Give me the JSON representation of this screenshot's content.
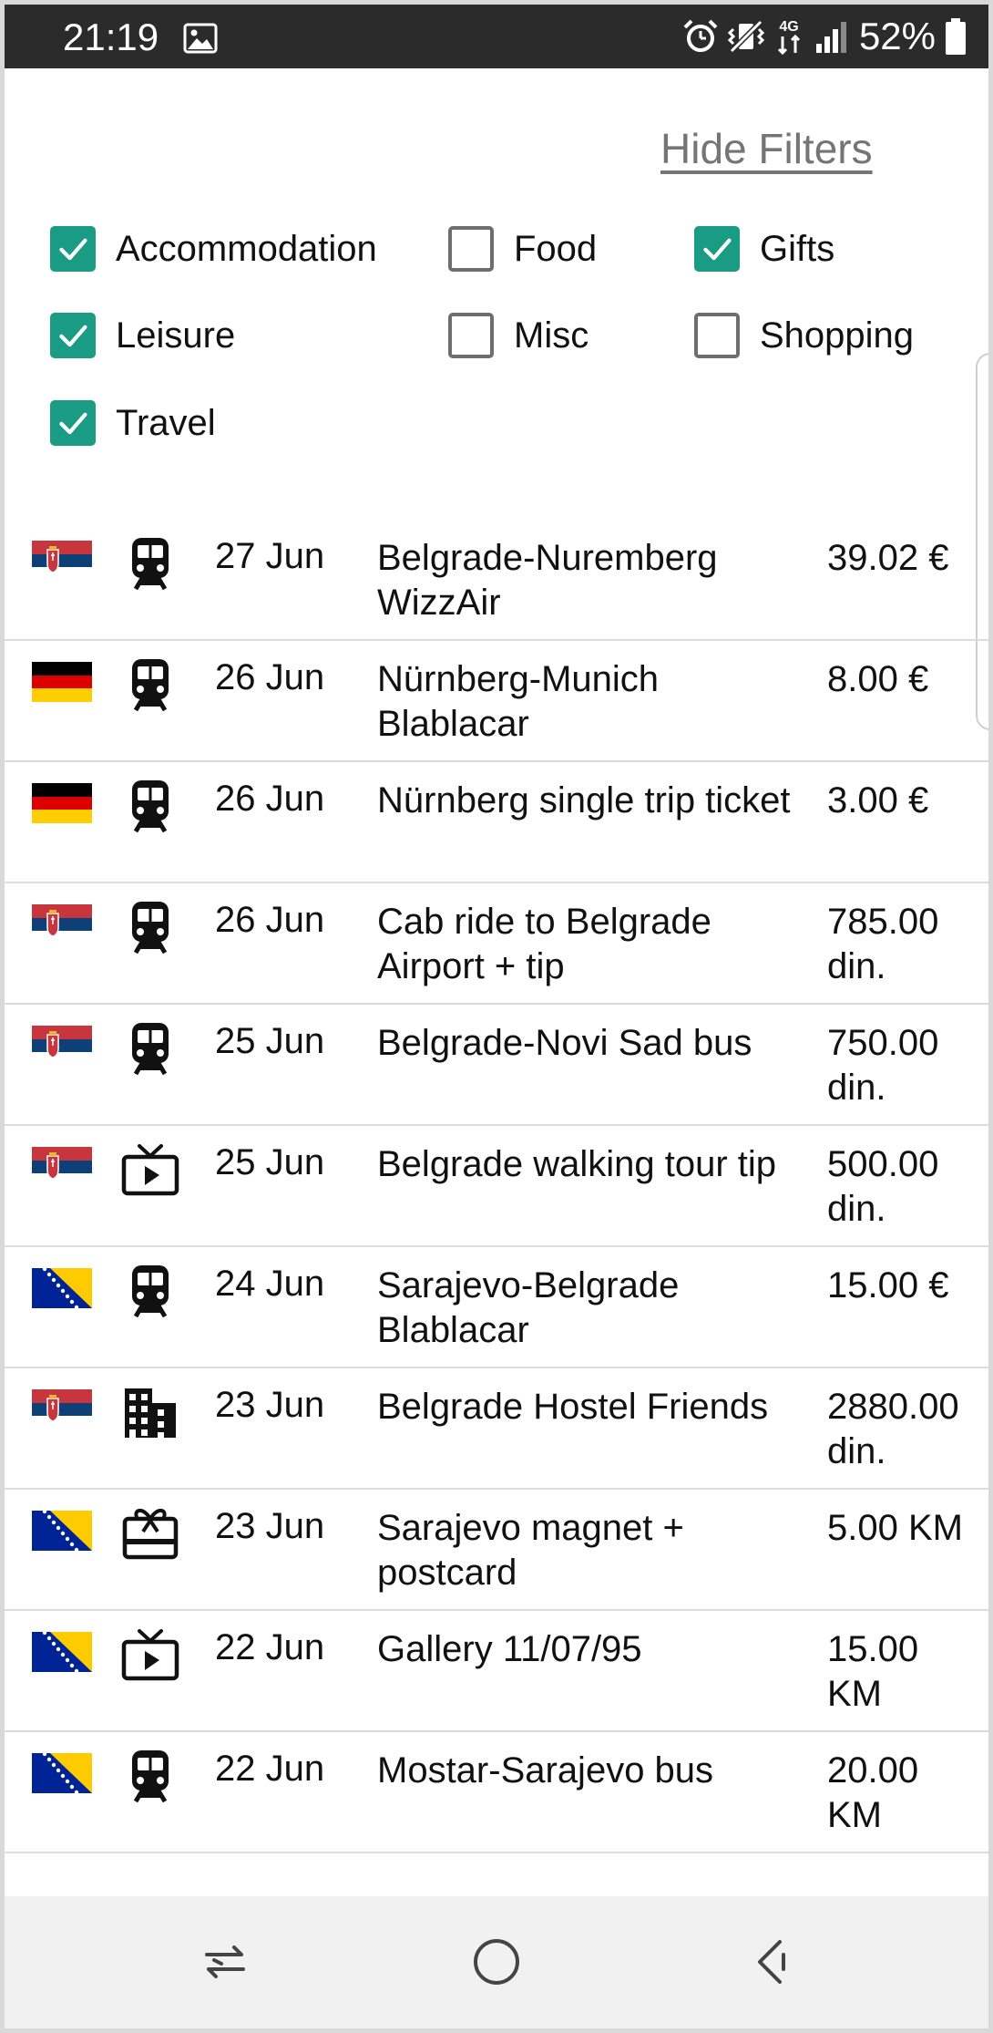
{
  "status_bar": {
    "time": "21:19",
    "battery_text": "52%",
    "network_label": "4G",
    "icons": [
      "image-icon",
      "alarm-icon",
      "vibrate-icon",
      "network-4g-icon",
      "signal-icon",
      "battery-icon"
    ]
  },
  "filters": {
    "toggle_label": "Hide Filters",
    "items": [
      {
        "label": "Accommodation",
        "checked": true
      },
      {
        "label": "Food",
        "checked": false
      },
      {
        "label": "Gifts",
        "checked": true
      },
      {
        "label": "Leisure",
        "checked": true
      },
      {
        "label": "Misc",
        "checked": false
      },
      {
        "label": "Shopping",
        "checked": false
      },
      {
        "label": "Travel",
        "checked": true
      }
    ]
  },
  "expenses": [
    {
      "flag": "serbia",
      "category": "train-icon",
      "date": "27 Jun",
      "description": "Belgrade-Nuremberg WizzAir",
      "amount": "39.02 €"
    },
    {
      "flag": "germany",
      "category": "train-icon",
      "date": "26 Jun",
      "description": "Nürnberg-Munich Blablacar",
      "amount": "8.00 €"
    },
    {
      "flag": "germany",
      "category": "train-icon",
      "date": "26 Jun",
      "description": "Nürnberg single trip ticket",
      "amount": "3.00 €"
    },
    {
      "flag": "serbia",
      "category": "train-icon",
      "date": "26 Jun",
      "description": "Cab ride to Belgrade Airport + tip",
      "amount": "785.00 din."
    },
    {
      "flag": "serbia",
      "category": "train-icon",
      "date": "25 Jun",
      "description": "Belgrade-Novi Sad bus",
      "amount": "750.00 din."
    },
    {
      "flag": "serbia",
      "category": "tv-icon",
      "date": "25 Jun",
      "description": "Belgrade walking tour tip",
      "amount": "500.00 din."
    },
    {
      "flag": "bosnia",
      "category": "train-icon",
      "date": "24 Jun",
      "description": "Sarajevo-Belgrade Blablacar",
      "amount": "15.00 €"
    },
    {
      "flag": "serbia",
      "category": "building-icon",
      "date": "23 Jun",
      "description": "Belgrade Hostel Friends",
      "amount": "2880.00 din."
    },
    {
      "flag": "bosnia",
      "category": "gift-card-icon",
      "date": "23 Jun",
      "description": "Sarajevo magnet + postcard",
      "amount": "5.00 KM"
    },
    {
      "flag": "bosnia",
      "category": "tv-icon",
      "date": "22 Jun",
      "description": "Gallery 11/07/95",
      "amount": "15.00 KM"
    },
    {
      "flag": "bosnia",
      "category": "train-icon",
      "date": "22 Jun",
      "description": "Mostar-Sarajevo bus",
      "amount": "20.00 KM"
    }
  ],
  "nav_bar": {
    "buttons": [
      "recent-apps-icon",
      "home-icon",
      "back-icon"
    ]
  },
  "colors": {
    "checkbox_checked": "#1a9b84",
    "status_bar_bg": "#2b2b2b",
    "link_gray": "#757575"
  }
}
